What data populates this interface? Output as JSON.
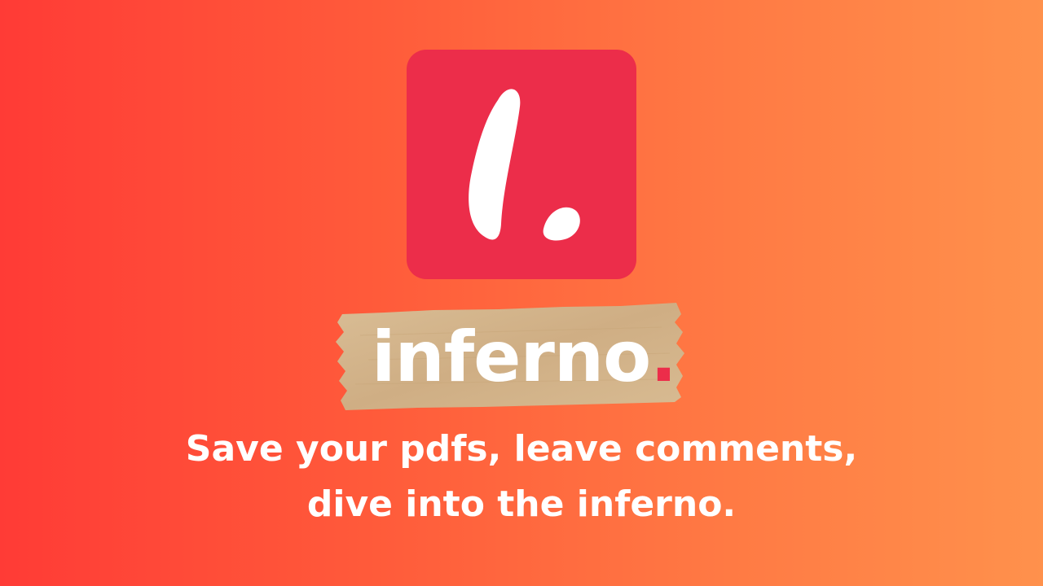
{
  "brand": {
    "icon": "brush-letter-l-with-dot-icon",
    "name": "inferno",
    "name_dot": ".",
    "accent_color": "#ec2d4a"
  },
  "tagline": {
    "line1": "Save your pdfs, leave comments,",
    "line2": "dive into the inferno."
  },
  "colors": {
    "gradient_start": "#ff3b36",
    "gradient_end": "#ff914c",
    "tape": "#d2b48c",
    "text": "#ffffff"
  }
}
